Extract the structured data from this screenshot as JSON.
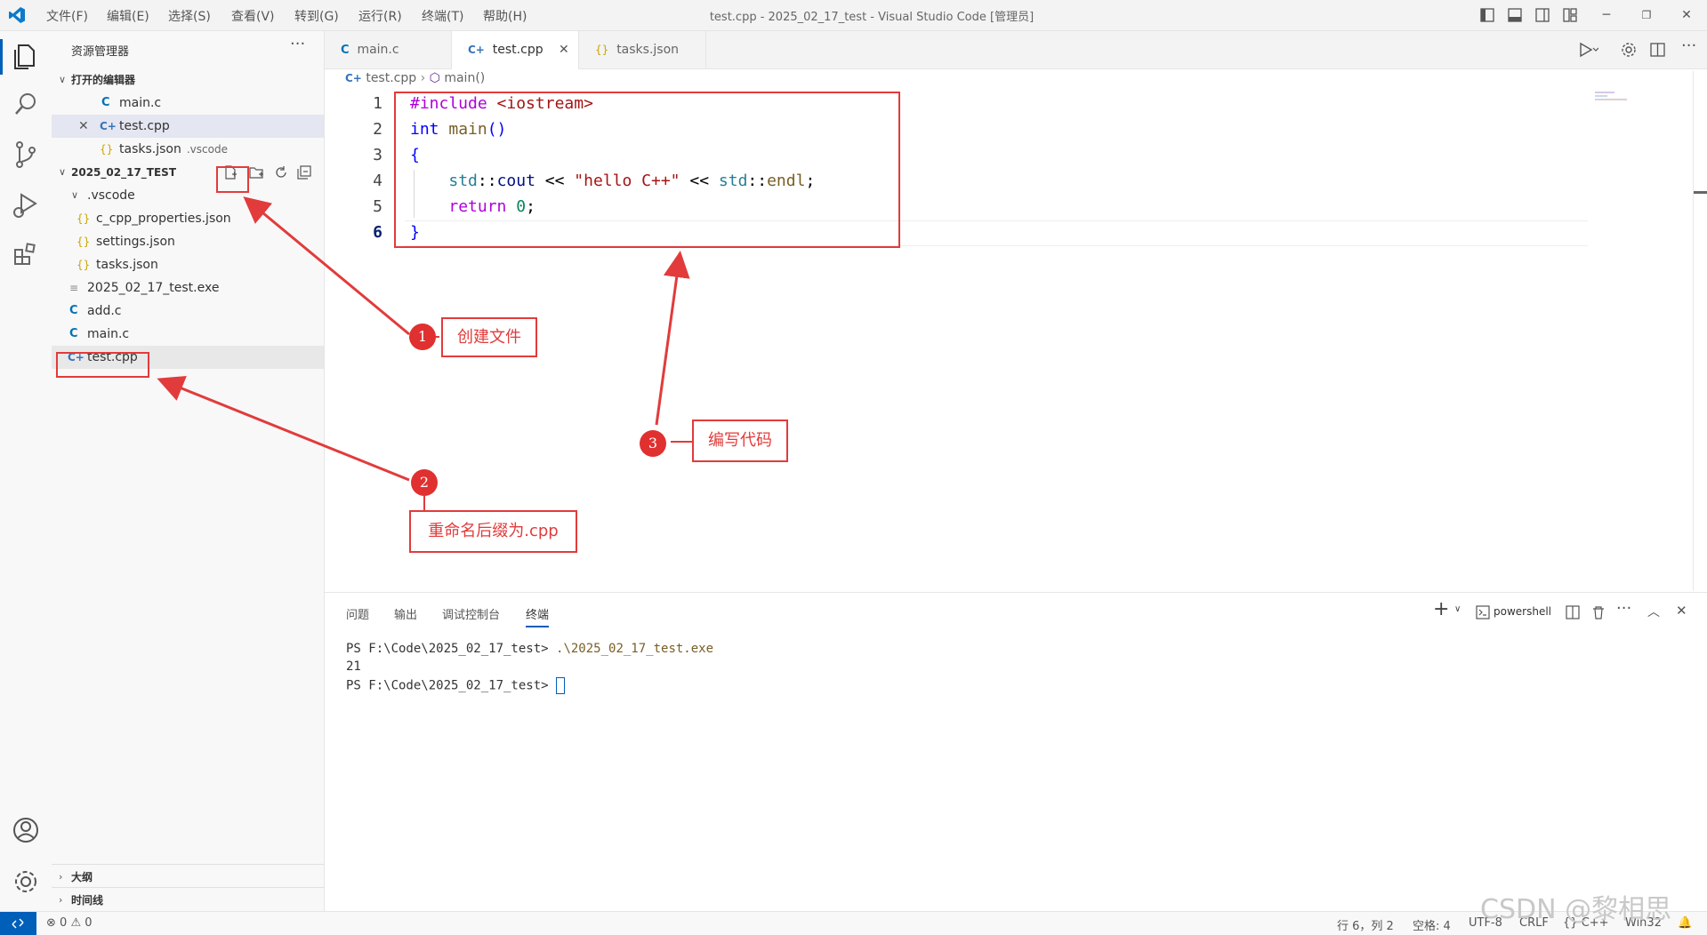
{
  "titlebar": {
    "menus": [
      "文件(F)",
      "编辑(E)",
      "选择(S)",
      "查看(V)",
      "转到(G)",
      "运行(R)",
      "终端(T)",
      "帮助(H)"
    ],
    "title": "test.cpp - 2025_02_17_test - Visual Studio Code [管理员]"
  },
  "sidebar": {
    "header": "资源管理器",
    "open_editors_title": "打开的编辑器",
    "open_editors": [
      {
        "icon": "C",
        "label": "main.c",
        "sub": ""
      },
      {
        "icon": "C++",
        "label": "test.cpp",
        "sub": ""
      },
      {
        "icon": "{}",
        "label": "tasks.json",
        "sub": ".vscode"
      }
    ],
    "folder_title": "2025_02_17_TEST",
    "tree": [
      {
        "icon": "chevron",
        "label": ".vscode"
      },
      {
        "icon": "{}",
        "label": "c_cpp_properties.json"
      },
      {
        "icon": "{}",
        "label": "settings.json"
      },
      {
        "icon": "{}",
        "label": "tasks.json"
      },
      {
        "icon": "exe",
        "label": "2025_02_17_test.exe"
      },
      {
        "icon": "C",
        "label": "add.c"
      },
      {
        "icon": "C",
        "label": "main.c"
      },
      {
        "icon": "C++",
        "label": "test.cpp"
      }
    ],
    "outline": "大纲",
    "timeline": "时间线"
  },
  "editor": {
    "tabs": [
      {
        "icon": "C",
        "label": "main.c"
      },
      {
        "icon": "C++",
        "label": "test.cpp"
      },
      {
        "icon": "{}",
        "label": "tasks.json"
      }
    ],
    "breadcrumb": {
      "file": "test.cpp",
      "symbol": "main()"
    },
    "line_numbers": [
      "1",
      "2",
      "3",
      "4",
      "5",
      "6"
    ],
    "code": {
      "l1_directive": "#include",
      "l1_header": "<iostream>",
      "l2_type": "int",
      "l2_name": "main",
      "l2_parens": "()",
      "l3_brace": "{",
      "l4_ns": "std",
      "l4_sep": "::",
      "l4_cout": "cout",
      "l4_op1": "<<",
      "l4_str": "\"hello C++\"",
      "l4_op2": "<<",
      "l4_ns2": "std",
      "l4_sep2": "::",
      "l4_endl": "endl",
      "l4_semi": ";",
      "l5_return": "return",
      "l5_num": "0",
      "l5_semi": ";",
      "l6_brace": "}"
    }
  },
  "panel": {
    "tabs": [
      "问题",
      "输出",
      "调试控制台",
      "终端"
    ],
    "shell": "powershell",
    "terminal": {
      "line1_prompt": "PS F:\\Code\\2025_02_17_test>",
      "line1_cmd": ".\\2025_02_17_test.exe",
      "line2": "21",
      "line3_prompt": "PS F:\\Code\\2025_02_17_test>"
    }
  },
  "statusbar": {
    "errors": "0",
    "warnings": "0",
    "position": "行 6，列 2",
    "spaces": "空格: 4",
    "encoding": "UTF-8",
    "eol": "CRLF",
    "language": "C++",
    "platform": "Win32"
  },
  "annotations": {
    "a1_num": "1",
    "a1_label": "创建文件",
    "a2_num": "2",
    "a2_label": "重命名后缀为.cpp",
    "a3_num": "3",
    "a3_label": "编写代码"
  },
  "watermark": "CSDN @黎相思",
  "colors": {
    "accent": "#005fb8",
    "annotation_red": "#e23b3b"
  }
}
